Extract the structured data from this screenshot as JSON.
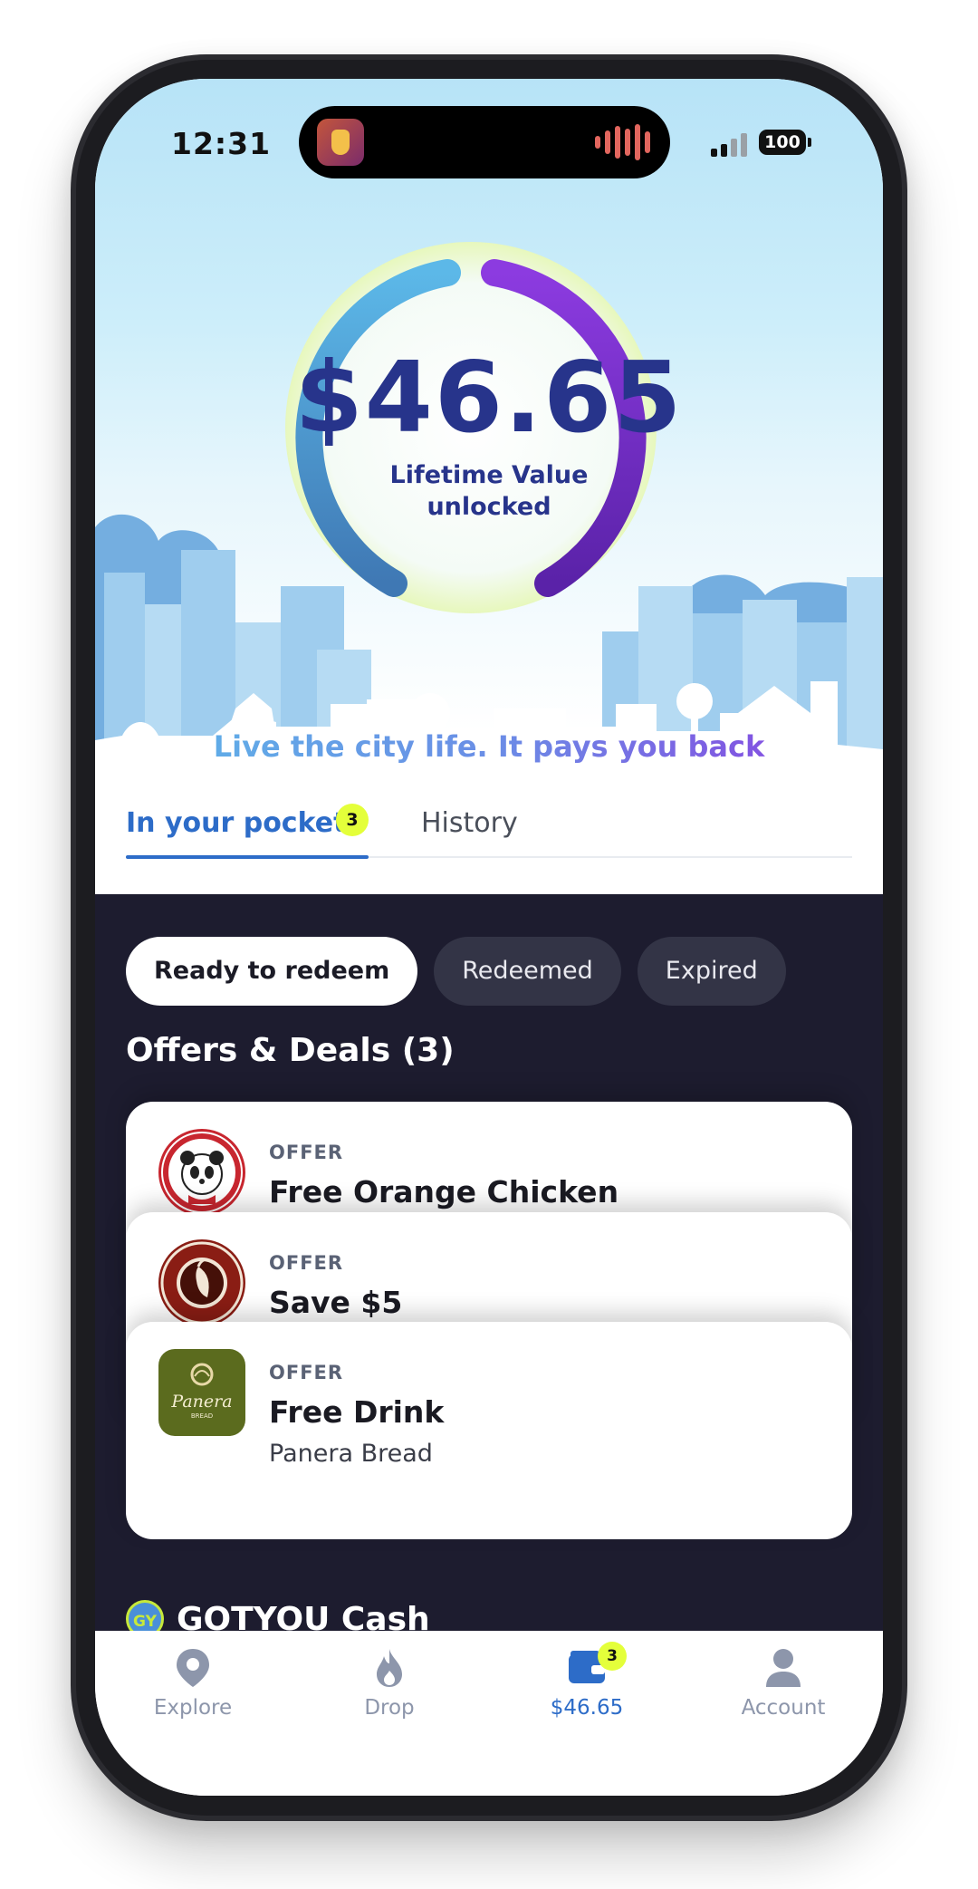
{
  "status_bar": {
    "time": "12:31",
    "battery": "100"
  },
  "hero": {
    "lifetime_value": "$46.65",
    "value_label_line1": "Lifetime Value",
    "value_label_line2": "unlocked",
    "tagline": "Live the city life. It pays you back"
  },
  "tabs": [
    {
      "label": "In your pocket",
      "badge": "3",
      "active": true
    },
    {
      "label": "History",
      "active": false
    }
  ],
  "filters": [
    {
      "label": "Ready to redeem",
      "active": true
    },
    {
      "label": "Redeemed",
      "active": false
    },
    {
      "label": "Expired",
      "active": false
    }
  ],
  "offers_section_title": "Offers & Deals (3)",
  "offers": [
    {
      "kicker": "OFFER",
      "title": "Free Orange Chicken",
      "merchant_logo": "panda-express-logo"
    },
    {
      "kicker": "OFFER",
      "title": "Save $5",
      "merchant_logo": "chipotle-logo"
    },
    {
      "kicker": "OFFER",
      "title": "Free Drink",
      "merchant": "Panera Bread",
      "merchant_logo": "panera-bread-logo",
      "logo_text": "Panera",
      "logo_subtext": "BREAD"
    }
  ],
  "cash_section": {
    "badge": "GY",
    "title": "GOTYOU Cash"
  },
  "bottom_nav": [
    {
      "label": "Explore",
      "icon": "map-pin-icon",
      "active": false
    },
    {
      "label": "Drop",
      "icon": "flame-icon",
      "active": false
    },
    {
      "label": "$46.65",
      "icon": "wallet-icon",
      "active": true,
      "badge": "3"
    },
    {
      "label": "Account",
      "icon": "person-icon",
      "active": false
    }
  ],
  "colors": {
    "accent_blue": "#2d6cc8",
    "value_navy": "#27348b",
    "badge_yellow": "#e4ff3a",
    "dark_bg": "#1d1c2f",
    "ring_start": "#5cb8e8",
    "ring_end": "#7a2fcf"
  }
}
